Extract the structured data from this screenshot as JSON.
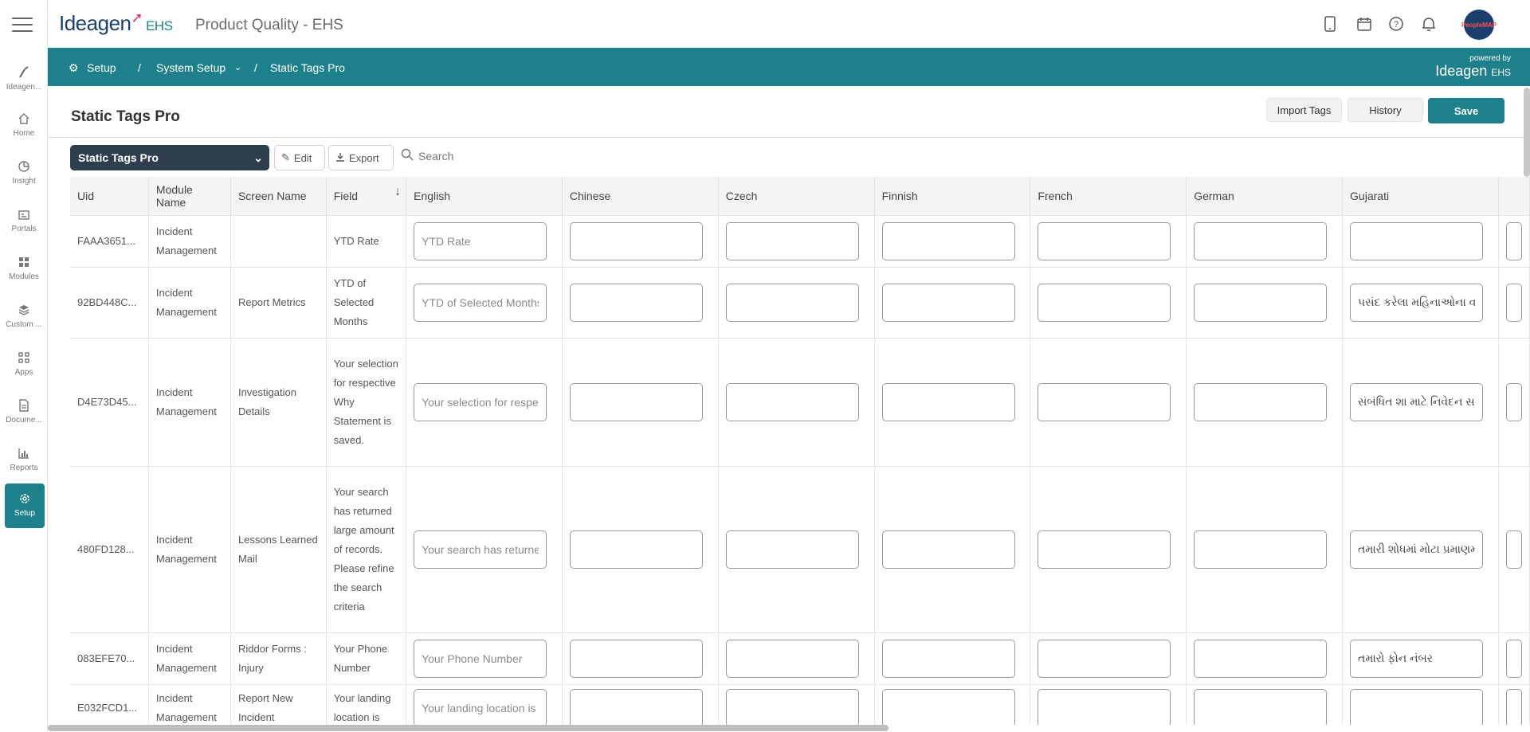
{
  "app": {
    "logo": "Ideagen",
    "logo_suffix": "EHS",
    "title": "Product Quality - EHS",
    "avatar_text": "PeopleMAP"
  },
  "sidebar": {
    "items": [
      {
        "label": "Ideagen...",
        "icon": "ideagen-icon"
      },
      {
        "label": "Home",
        "icon": "home-icon"
      },
      {
        "label": "Insight",
        "icon": "insight-icon"
      },
      {
        "label": "Portals",
        "icon": "portals-icon"
      },
      {
        "label": "Modules",
        "icon": "modules-icon"
      },
      {
        "label": "Custom ...",
        "icon": "custom-icon"
      },
      {
        "label": "Apps",
        "icon": "apps-icon"
      },
      {
        "label": "Docume...",
        "icon": "document-icon"
      },
      {
        "label": "Reports",
        "icon": "reports-icon"
      },
      {
        "label": "Setup",
        "icon": "setup-icon",
        "active": true
      }
    ]
  },
  "breadcrumb": {
    "root": "Setup",
    "sep1": "/",
    "middle": "System Setup",
    "sep2": "/",
    "current": "Static Tags Pro"
  },
  "powered": {
    "line1": "powered by",
    "brand": "Ideagen",
    "suffix": "EHS"
  },
  "page": {
    "title": "Static Tags Pro"
  },
  "actions": {
    "import": "Import Tags",
    "history": "History",
    "save": "Save"
  },
  "toolbar": {
    "selected_list": "Static Tags Pro",
    "edit": "Edit",
    "export": "Export",
    "search_placeholder": "Search"
  },
  "table": {
    "columns": [
      "Uid",
      "Module Name",
      "Screen Name",
      "Field",
      "English",
      "Chinese",
      "Czech",
      "Finnish",
      "French",
      "German",
      "Gujarati"
    ],
    "rows": [
      {
        "uid": "FAAA3651...",
        "module": "Incident Management",
        "screen": "",
        "field": "YTD Rate",
        "english": "YTD Rate",
        "gujarati": ""
      },
      {
        "uid": "92BD448C...",
        "module": "Incident Management",
        "screen": "Report Metrics",
        "field": "YTD of Selected Months",
        "english": "YTD of Selected Months",
        "gujarati": "પસંદ કરેલા મહિનાઓના વાયટીડી"
      },
      {
        "uid": "D4E73D45...",
        "module": "Incident Management",
        "screen": "Investigation Details",
        "field": "Your selection for respective Why Statement is saved.",
        "english": "Your selection for respective Why Statement is saved.",
        "gujarati": "સંબંધિત શા માટે નિવેદન સાચવવામાં આવ્યું"
      },
      {
        "uid": "480FD128...",
        "module": "Incident Management",
        "screen": "Lessons Learned Mail",
        "field": "Your search has returned large amount of records. Please refine the search criteria",
        "english": "Your search has returned large amount of records.",
        "gujarati": "તમારી શોધમાં મોટા પ્રમાણમાં રેકોર્ડ્સ"
      },
      {
        "uid": "083EFE70...",
        "module": "Incident Management",
        "screen": "Riddor Forms : Injury",
        "field": "Your Phone Number",
        "english": "Your Phone Number",
        "gujarati": "તમારો ફોન નંબર"
      },
      {
        "uid": "E032FCD1...",
        "module": "Incident Management",
        "screen": "Report New Incident",
        "field": "Your landing location is",
        "english": "Your landing location is",
        "gujarati": ""
      }
    ]
  },
  "colors": {
    "accent": "#1e808a",
    "select_bg": "#2f3e4e",
    "brand": "#1c3f6e"
  }
}
